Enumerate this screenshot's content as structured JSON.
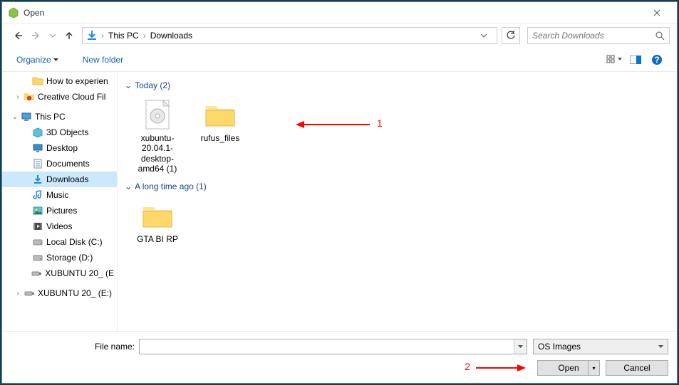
{
  "window": {
    "title": "Open"
  },
  "nav": {
    "crumbs": [
      "This PC",
      "Downloads"
    ],
    "search_placeholder": "Search Downloads"
  },
  "toolbar": {
    "organize": "Organize",
    "new_folder": "New folder"
  },
  "sidebar": [
    {
      "indent": 28,
      "icon": "folder",
      "label": "How to experien",
      "exp": ""
    },
    {
      "indent": 16,
      "icon": "cc",
      "label": "Creative Cloud Fil",
      "exp": ">"
    },
    {
      "indent": 12,
      "icon": "pc",
      "label": "This PC",
      "exp": "v"
    },
    {
      "indent": 28,
      "icon": "3d",
      "label": "3D Objects",
      "exp": ""
    },
    {
      "indent": 28,
      "icon": "desktop",
      "label": "Desktop",
      "exp": ""
    },
    {
      "indent": 28,
      "icon": "docs",
      "label": "Documents",
      "exp": ""
    },
    {
      "indent": 28,
      "icon": "downloads",
      "label": "Downloads",
      "exp": "",
      "selected": true
    },
    {
      "indent": 28,
      "icon": "music",
      "label": "Music",
      "exp": ""
    },
    {
      "indent": 28,
      "icon": "pictures",
      "label": "Pictures",
      "exp": ""
    },
    {
      "indent": 28,
      "icon": "videos",
      "label": "Videos",
      "exp": ""
    },
    {
      "indent": 28,
      "icon": "drive",
      "label": "Local Disk (C:)",
      "exp": ""
    },
    {
      "indent": 28,
      "icon": "drive",
      "label": "Storage (D:)",
      "exp": ""
    },
    {
      "indent": 28,
      "icon": "usb",
      "label": "XUBUNTU 20_ (E",
      "exp": ""
    },
    {
      "indent": 16,
      "icon": "usb",
      "label": "XUBUNTU 20_ (E:)",
      "exp": ">"
    }
  ],
  "files": {
    "groups": [
      {
        "title": "Today (2)",
        "items": [
          {
            "icon": "iso",
            "name": "xubuntu-20.04.1-desktop-amd64 (1)"
          },
          {
            "icon": "folder-big",
            "name": "rufus_files"
          }
        ]
      },
      {
        "title": "A long time ago (1)",
        "items": [
          {
            "icon": "folder-big",
            "name": "GTA BI RP"
          }
        ]
      }
    ]
  },
  "bottom": {
    "filename_label": "File name:",
    "filename_value": "",
    "filter": "OS Images",
    "open": "Open",
    "cancel": "Cancel"
  },
  "annotations": {
    "label1": "1",
    "label2": "2"
  }
}
